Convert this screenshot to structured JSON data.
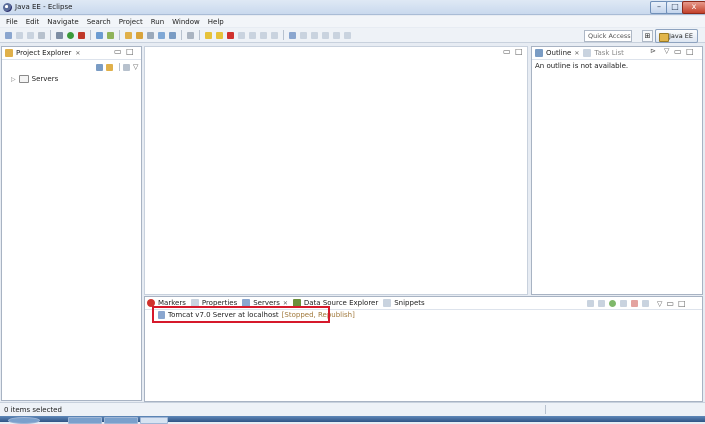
{
  "window": {
    "title": "Java EE - Eclipse",
    "min_label": "–",
    "max_label": "□",
    "close_label": "x"
  },
  "menu": [
    "File",
    "Edit",
    "Navigate",
    "Search",
    "Project",
    "Run",
    "Window",
    "Help"
  ],
  "toolbar": {
    "quick_access_placeholder": "Quick Access",
    "open_perspective_label": "⊞",
    "perspective_label": "Java EE"
  },
  "project_explorer": {
    "tab_label": "Project Explorer",
    "tab_close": "✕",
    "tree": [
      {
        "label": "Servers",
        "expanded": false
      }
    ]
  },
  "outline": {
    "tabs": [
      {
        "label": "Outline",
        "active": true
      },
      {
        "label": "Task List",
        "active": false
      }
    ],
    "message": "An outline is not available."
  },
  "servers_panel": {
    "tabs": [
      {
        "label": "Markers",
        "active": false
      },
      {
        "label": "Properties",
        "active": false
      },
      {
        "label": "Servers",
        "active": true
      },
      {
        "label": "Data Source Explorer",
        "active": false
      },
      {
        "label": "Snippets",
        "active": false
      }
    ],
    "servers": [
      {
        "name": "Tomcat v7.0 Server at localhost",
        "state": "[Stopped, Republish]"
      }
    ]
  },
  "status": {
    "text": "0 items selected"
  },
  "colors": {
    "highlight": "#d6192b",
    "state_text": "#a0783a",
    "link_text": "#1f3fa8"
  }
}
